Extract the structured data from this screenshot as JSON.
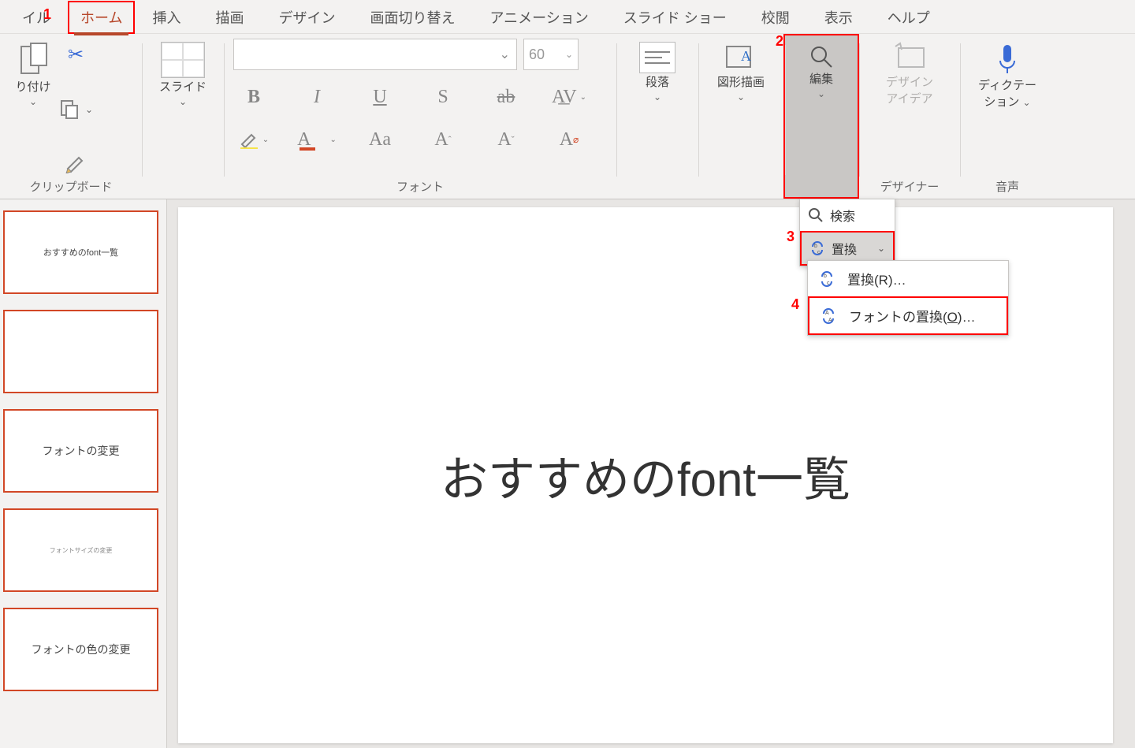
{
  "tabs": {
    "file": "イル",
    "home": "ホーム",
    "insert": "挿入",
    "draw": "描画",
    "design": "デザイン",
    "transitions": "画面切り替え",
    "animations": "アニメーション",
    "slideshow": "スライド ショー",
    "review": "校閲",
    "view": "表示",
    "help": "ヘルプ"
  },
  "ribbon": {
    "clipboard": {
      "paste": "り付け",
      "label": "クリップボード"
    },
    "slide": {
      "label": "スライド"
    },
    "font": {
      "size": "60",
      "label": "フォント",
      "buttons": {
        "aa": "Aa",
        "big": "A",
        "small": "A",
        "clear": "A"
      }
    },
    "paragraph": {
      "label": "段落"
    },
    "drawing": {
      "label": "図形描画"
    },
    "editing": {
      "label": "編集"
    },
    "designer": {
      "aidia_l1": "デザイン",
      "aidia_l2": "アイデア",
      "label": "デザイナー"
    },
    "voice": {
      "dictate_l1": "ディクテー",
      "dictate_l2": "ション",
      "label": "音声"
    }
  },
  "edit_menu": {
    "search": "検索",
    "replace": "置換",
    "sub_replace": "置換(R)…",
    "sub_font_replace_pre": "フォントの置換(",
    "sub_font_replace_acc": "O",
    "sub_font_replace_post": ")…"
  },
  "slide": {
    "title": "おすすめのfont一覧"
  },
  "thumbs": [
    "おすすめのfont一覧",
    "",
    "フォントの変更",
    "フォントサイズの変更",
    "フォントの色の変更"
  ],
  "anno": {
    "n1": "1",
    "n2": "2",
    "n3": "3",
    "n4": "4"
  }
}
